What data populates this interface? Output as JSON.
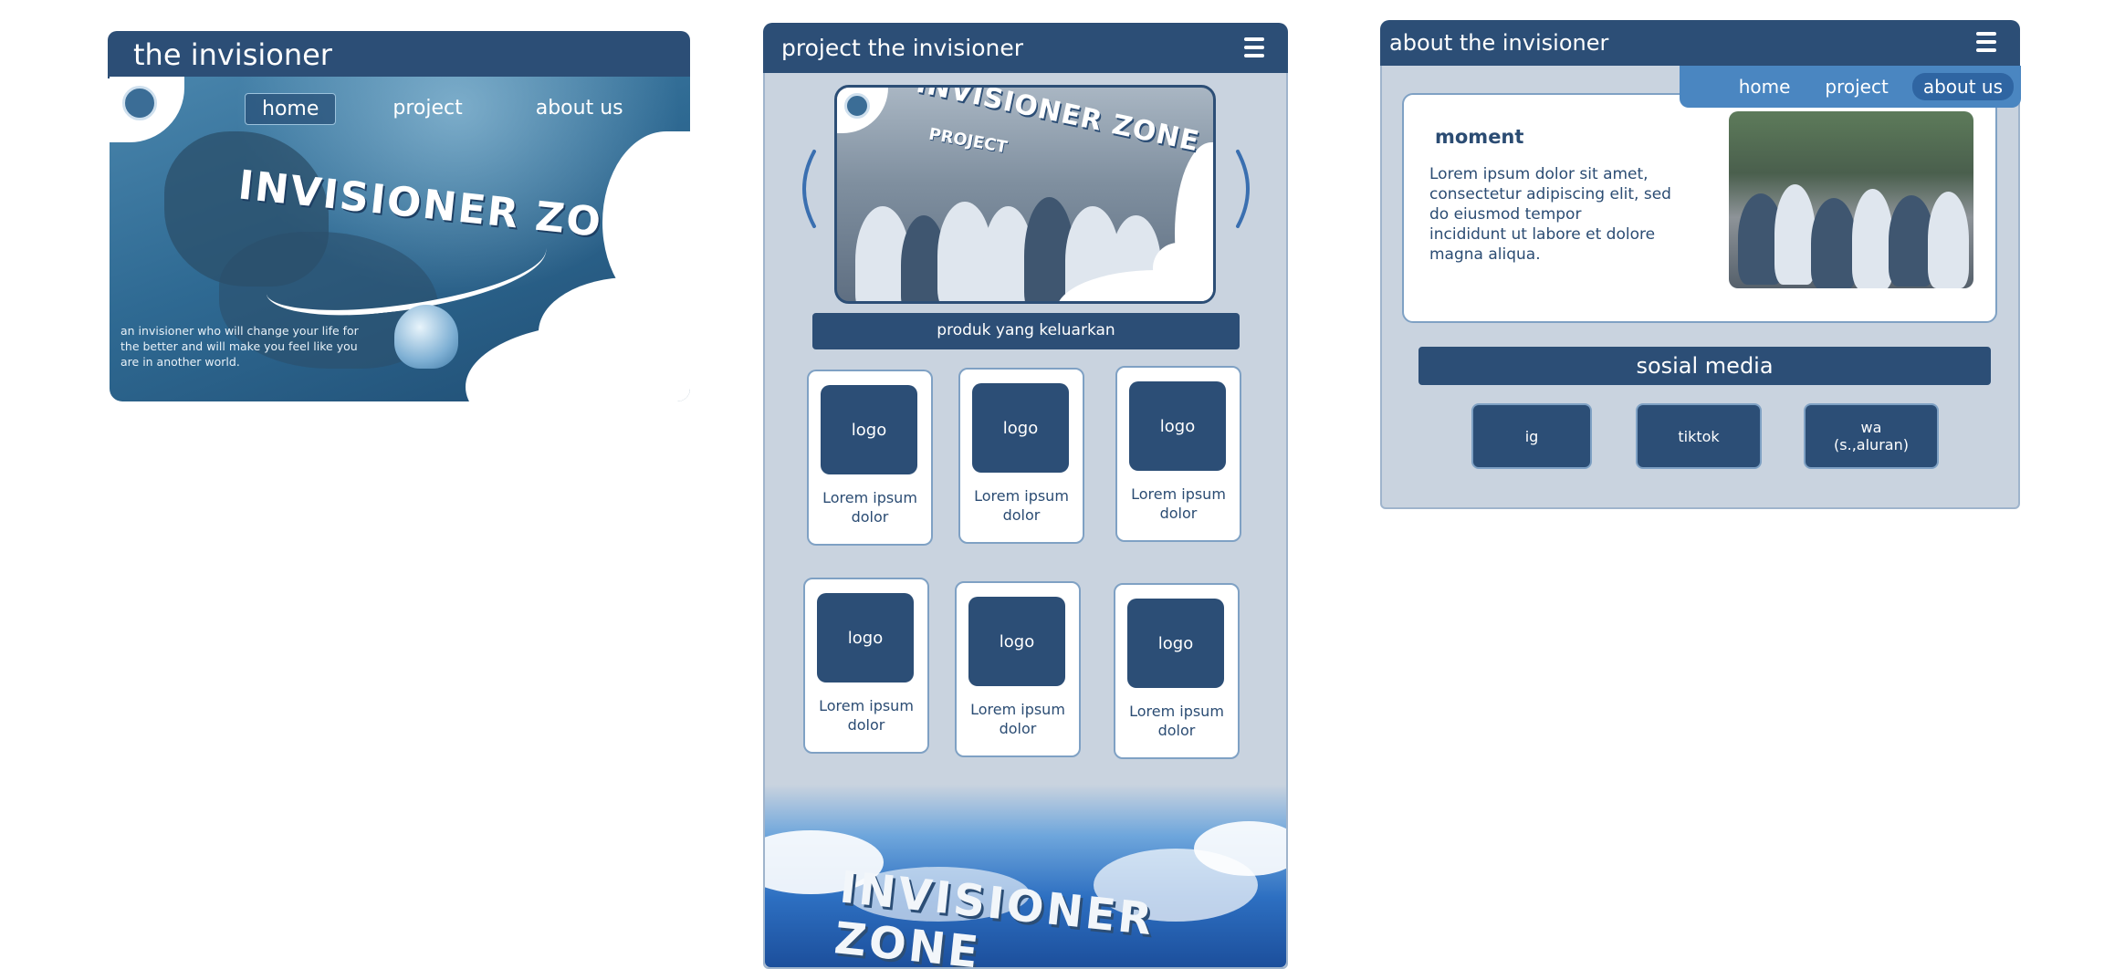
{
  "home_window": {
    "title": "the invisioner",
    "nav": [
      "home",
      "project",
      "about us"
    ],
    "active_nav": "home",
    "hero_logo": "INVISIONER ZONE",
    "tagline": "an invisioner who will change your life for the better and will make you feel like you are in another world."
  },
  "project_window": {
    "title": "project the invisioner",
    "carousel": {
      "title": "INVISIONER ZONE",
      "subtitle": "PROJECT"
    },
    "section_title": "produk yang keluarkan",
    "products": [
      {
        "logo": "logo",
        "caption": "Lorem ipsum dolor"
      },
      {
        "logo": "logo",
        "caption": "Lorem ipsum dolor"
      },
      {
        "logo": "logo",
        "caption": "Lorem ipsum dolor"
      },
      {
        "logo": "logo",
        "caption": "Lorem ipsum dolor"
      },
      {
        "logo": "logo",
        "caption": "Lorem ipsum dolor"
      },
      {
        "logo": "logo",
        "caption": "Lorem ipsum dolor"
      }
    ],
    "footer_logo": "INVISIONER ZONE"
  },
  "about_window": {
    "title": "about the invisioner",
    "nav": [
      "home",
      "project",
      "about us"
    ],
    "active_nav": "about us",
    "moment": {
      "title": "moment",
      "text": "Lorem ipsum dolor sit amet,\nconsectetur adipiscing elit, sed\ndo eiusmod tempor\n incididunt ut labore et dolore\nmagna aliqua."
    },
    "social_title": "sosial media",
    "social_buttons": [
      "ig",
      "tiktok",
      "wa\n(s.,aluran)"
    ]
  },
  "colors": {
    "primary": "#2c4e76",
    "panel_bg": "#c9d3df",
    "accent": "#4a86c1"
  }
}
